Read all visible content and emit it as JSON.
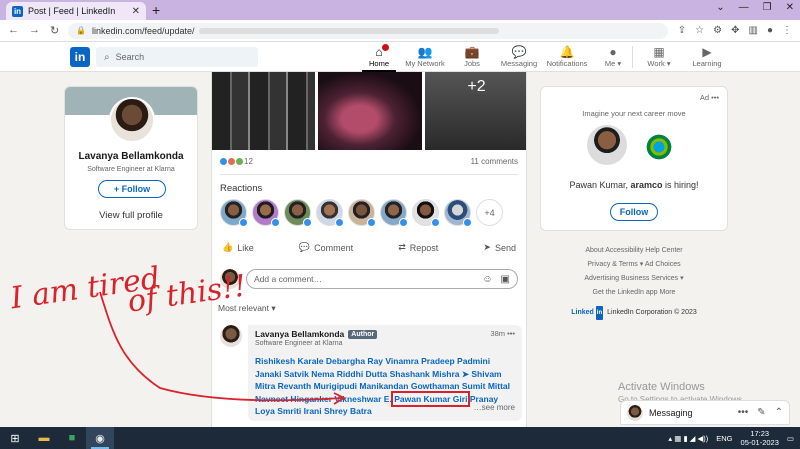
{
  "browser": {
    "tab_title": "Post | Feed | LinkedIn",
    "url": "linkedin.com/feed/update/"
  },
  "header": {
    "search_placeholder": "Search",
    "nav": [
      {
        "label": "Home"
      },
      {
        "label": "My Network"
      },
      {
        "label": "Jobs"
      },
      {
        "label": "Messaging"
      },
      {
        "label": "Notifications"
      },
      {
        "label": "Me ▾"
      },
      {
        "label": "Work ▾"
      },
      {
        "label": "Learning"
      }
    ]
  },
  "profile": {
    "name": "Lavanya Bellamkonda",
    "title": "Software Engineer at Klarna",
    "follow_label": "+ Follow",
    "view_full_label": "View full profile"
  },
  "post": {
    "photo_more": "+2",
    "reaction_count": "12",
    "comment_count": "11 comments",
    "reactions_title": "Reactions",
    "more_reactors": "+4",
    "actions": {
      "like": "Like",
      "comment": "Comment",
      "repost": "Repost",
      "send": "Send"
    },
    "compose_placeholder": "Add a comment…",
    "sort_label": "Most relevant ▾"
  },
  "comment": {
    "author": "Lavanya Bellamkonda",
    "badge": "Author",
    "time": "38m",
    "subtitle": "Software Engineer at Klarna",
    "text_before": "Rishikesh Karale Debargha Ray Vinamra Pradeep Padmini Janaki Satvik Nema Riddhi Dutta Shashank Mishra ➤ Shivam Mitra Revanth Murigipudi Manikandan Gowthaman Sumit Mittal Navneet Hinganker Vikneshwar E.",
    "highlighted_name": "Pawan Kumar Giri",
    "text_after": "Pranay Loya Smriti Irani Shrey Batra",
    "see_more": "…see more"
  },
  "ad": {
    "tag": "Ad",
    "line": "Imagine your next career move",
    "text_pre": "Pawan Kumar, ",
    "text_company": "aramco",
    "text_post": " is hiring!",
    "follow_label": "Follow"
  },
  "footer": {
    "row1": "About    Accessibility    Help Center",
    "row2": "Privacy & Terms ▾    Ad Choices",
    "row3": "Advertising    Business Services ▾",
    "row4": "Get the LinkedIn app    More",
    "copyright_brand": "Linked",
    "copyright_in": "in",
    "copyright_text": "LinkedIn Corporation © 2023"
  },
  "watermark": {
    "title": "Activate Windows",
    "subtitle": "Go to Settings to activate Windows."
  },
  "messaging": {
    "label": "Messaging"
  },
  "taskbar": {
    "lang": "ENG",
    "time": "17:23",
    "date": "05-01-2023"
  },
  "annotation": {
    "handwriting": "I am tired of this!!",
    "color": "#d8232a"
  },
  "colors": {
    "brand": "#0a66c2",
    "highlight_box": "#d8232a"
  }
}
